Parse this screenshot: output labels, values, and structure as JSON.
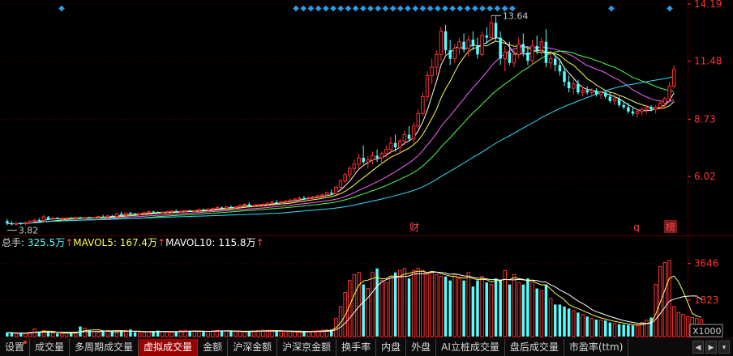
{
  "chart_data": {
    "type": "candlestick",
    "price_axis": {
      "ticks": [
        "14.19",
        "11.48",
        "8.73",
        "6.02"
      ],
      "ylim": [
        3.3,
        14.19
      ]
    },
    "annotations": {
      "high": "13.64",
      "low": "3.82",
      "markers": [
        "财",
        "q",
        "榜"
      ]
    },
    "candles": [
      [
        3.9,
        4.0,
        3.7,
        3.8
      ],
      [
        3.8,
        3.9,
        3.7,
        3.75
      ],
      [
        3.75,
        3.85,
        3.7,
        3.8
      ],
      [
        3.8,
        3.85,
        3.72,
        3.78
      ],
      [
        3.78,
        3.9,
        3.7,
        3.82
      ],
      [
        3.82,
        3.95,
        3.8,
        3.9
      ],
      [
        3.9,
        4.0,
        3.85,
        3.95
      ],
      [
        3.95,
        4.05,
        3.9,
        3.93
      ],
      [
        3.93,
        4.2,
        3.9,
        4.1
      ],
      [
        4.1,
        4.15,
        3.95,
        4.0
      ],
      [
        4.0,
        4.1,
        3.95,
        4.05
      ],
      [
        4.05,
        4.1,
        3.98,
        4.0
      ],
      [
        4.0,
        4.05,
        3.95,
        4.02
      ],
      [
        4.02,
        4.1,
        3.98,
        4.05
      ],
      [
        4.05,
        4.1,
        4.0,
        4.03
      ],
      [
        4.03,
        4.1,
        4.0,
        4.08
      ],
      [
        4.08,
        4.12,
        4.02,
        4.05
      ],
      [
        4.05,
        4.1,
        4.0,
        4.07
      ],
      [
        4.07,
        4.12,
        4.03,
        4.05
      ],
      [
        4.05,
        4.1,
        4.0,
        4.08
      ],
      [
        4.08,
        4.15,
        4.05,
        4.12
      ],
      [
        4.12,
        4.2,
        4.08,
        4.1
      ],
      [
        4.1,
        4.18,
        4.05,
        4.15
      ],
      [
        4.15,
        4.2,
        4.1,
        4.12
      ],
      [
        4.12,
        4.3,
        4.1,
        4.25
      ],
      [
        4.25,
        4.35,
        4.15,
        4.2
      ],
      [
        4.2,
        4.3,
        4.15,
        4.28
      ],
      [
        4.28,
        4.35,
        4.2,
        4.25
      ],
      [
        4.25,
        4.3,
        4.15,
        4.2
      ],
      [
        4.2,
        4.3,
        4.18,
        4.27
      ],
      [
        4.27,
        4.35,
        4.22,
        4.3
      ],
      [
        4.3,
        4.4,
        4.25,
        4.35
      ],
      [
        4.35,
        4.4,
        4.28,
        4.32
      ],
      [
        4.32,
        4.38,
        4.28,
        4.3
      ],
      [
        4.3,
        4.35,
        4.25,
        4.33
      ],
      [
        4.33,
        4.4,
        4.3,
        4.35
      ],
      [
        4.35,
        4.4,
        4.3,
        4.38
      ],
      [
        4.38,
        4.45,
        4.3,
        4.35
      ],
      [
        4.35,
        4.4,
        4.3,
        4.37
      ],
      [
        4.37,
        4.42,
        4.32,
        4.4
      ],
      [
        4.4,
        4.45,
        4.35,
        4.38
      ],
      [
        4.38,
        4.42,
        4.33,
        4.4
      ],
      [
        4.4,
        4.5,
        4.35,
        4.45
      ],
      [
        4.45,
        4.5,
        4.38,
        4.42
      ],
      [
        4.42,
        4.5,
        4.4,
        4.48
      ],
      [
        4.48,
        4.55,
        4.42,
        4.5
      ],
      [
        4.5,
        4.6,
        4.45,
        4.55
      ],
      [
        4.55,
        4.6,
        4.5,
        4.52
      ],
      [
        4.52,
        4.6,
        4.5,
        4.58
      ],
      [
        4.58,
        4.65,
        4.5,
        4.55
      ],
      [
        4.55,
        4.6,
        4.5,
        4.58
      ],
      [
        4.58,
        4.7,
        4.55,
        4.65
      ],
      [
        4.65,
        4.75,
        4.6,
        4.7
      ],
      [
        4.7,
        4.8,
        4.6,
        4.62
      ],
      [
        4.62,
        4.7,
        4.55,
        4.65
      ],
      [
        4.65,
        4.72,
        4.6,
        4.68
      ],
      [
        4.68,
        4.75,
        4.62,
        4.7
      ],
      [
        4.7,
        4.8,
        4.65,
        4.75
      ],
      [
        4.75,
        4.85,
        4.7,
        4.8
      ],
      [
        4.8,
        4.9,
        4.72,
        4.78
      ],
      [
        4.78,
        4.85,
        4.7,
        4.82
      ],
      [
        4.82,
        4.9,
        4.75,
        4.85
      ],
      [
        4.85,
        4.95,
        4.8,
        4.9
      ],
      [
        4.9,
        5.0,
        4.85,
        4.95
      ],
      [
        4.95,
        5.05,
        4.88,
        5.0
      ],
      [
        5.0,
        5.1,
        4.9,
        4.98
      ],
      [
        4.98,
        5.05,
        4.9,
        5.02
      ],
      [
        5.02,
        5.1,
        4.95,
        5.05
      ],
      [
        5.05,
        5.15,
        5.0,
        5.1
      ],
      [
        5.1,
        5.2,
        5.05,
        5.15
      ],
      [
        5.15,
        5.3,
        5.1,
        5.25
      ],
      [
        5.25,
        5.4,
        5.15,
        5.2
      ],
      [
        5.2,
        5.6,
        5.15,
        5.5
      ],
      [
        5.5,
        5.9,
        5.4,
        5.8
      ],
      [
        5.8,
        6.2,
        5.7,
        6.1
      ],
      [
        6.1,
        6.5,
        5.9,
        6.4
      ],
      [
        6.4,
        6.8,
        6.2,
        6.6
      ],
      [
        6.6,
        7.1,
        6.4,
        6.9
      ],
      [
        6.9,
        7.5,
        6.6,
        6.7
      ],
      [
        6.7,
        7.0,
        6.4,
        6.8
      ],
      [
        6.8,
        7.2,
        6.6,
        7.0
      ],
      [
        7.0,
        7.3,
        6.7,
        6.9
      ],
      [
        6.9,
        7.2,
        6.6,
        7.1
      ],
      [
        7.1,
        7.5,
        6.9,
        7.3
      ],
      [
        7.3,
        7.9,
        7.1,
        7.6
      ],
      [
        7.6,
        8.0,
        7.2,
        7.4
      ],
      [
        7.4,
        7.8,
        7.1,
        7.7
      ],
      [
        7.7,
        8.2,
        7.5,
        8.0
      ],
      [
        8.0,
        8.4,
        7.7,
        7.8
      ],
      [
        7.8,
        8.6,
        7.6,
        8.4
      ],
      [
        8.4,
        9.2,
        8.2,
        9.0
      ],
      [
        9.0,
        10.0,
        8.9,
        9.8
      ],
      [
        9.8,
        11.0,
        9.6,
        10.8
      ],
      [
        10.8,
        11.6,
        10.4,
        11.2
      ],
      [
        11.2,
        12.0,
        10.8,
        11.8
      ],
      [
        11.8,
        13.1,
        11.5,
        12.9
      ],
      [
        12.9,
        13.2,
        11.8,
        12.0
      ],
      [
        12.0,
        12.5,
        11.3,
        11.6
      ],
      [
        11.6,
        12.3,
        11.4,
        12.1
      ],
      [
        12.1,
        12.6,
        11.8,
        12.4
      ],
      [
        12.4,
        12.8,
        11.9,
        12.1
      ],
      [
        12.1,
        12.7,
        11.7,
        12.5
      ],
      [
        12.5,
        12.9,
        12.0,
        12.2
      ],
      [
        12.2,
        12.6,
        11.6,
        11.8
      ],
      [
        11.8,
        12.9,
        11.7,
        12.7
      ],
      [
        12.7,
        13.1,
        12.3,
        12.6
      ],
      [
        12.6,
        13.64,
        12.5,
        13.3
      ],
      [
        13.3,
        13.6,
        12.4,
        12.6
      ],
      [
        12.6,
        12.9,
        11.3,
        11.6
      ],
      [
        11.6,
        12.2,
        11.0,
        11.9
      ],
      [
        11.9,
        12.4,
        11.3,
        11.4
      ],
      [
        11.4,
        12.0,
        11.2,
        11.8
      ],
      [
        11.8,
        12.6,
        11.6,
        12.3
      ],
      [
        12.3,
        12.8,
        11.7,
        11.9
      ],
      [
        11.9,
        12.2,
        11.3,
        11.5
      ],
      [
        11.5,
        12.5,
        11.3,
        12.2
      ],
      [
        12.2,
        12.7,
        11.8,
        12.0
      ],
      [
        12.0,
        12.6,
        11.7,
        12.4
      ],
      [
        12.4,
        13.0,
        11.2,
        11.4
      ],
      [
        11.4,
        11.9,
        11.1,
        11.6
      ],
      [
        11.6,
        11.8,
        11.0,
        11.3
      ],
      [
        11.3,
        11.6,
        10.8,
        11.0
      ],
      [
        11.0,
        11.2,
        10.3,
        10.5
      ],
      [
        10.5,
        10.8,
        10.0,
        10.2
      ],
      [
        10.2,
        10.6,
        9.9,
        10.4
      ],
      [
        10.4,
        10.6,
        9.9,
        10.0
      ],
      [
        10.0,
        10.3,
        9.8,
        10.1
      ],
      [
        10.1,
        10.3,
        9.9,
        10.0
      ],
      [
        10.0,
        10.2,
        9.8,
        10.1
      ],
      [
        10.1,
        10.2,
        9.8,
        9.9
      ],
      [
        9.9,
        10.1,
        9.7,
        10.0
      ],
      [
        10.0,
        10.1,
        9.7,
        9.8
      ],
      [
        9.8,
        10.0,
        9.5,
        9.6
      ],
      [
        9.6,
        9.9,
        9.4,
        9.7
      ],
      [
        9.7,
        9.8,
        9.3,
        9.4
      ],
      [
        9.4,
        9.6,
        9.2,
        9.3
      ],
      [
        9.3,
        9.5,
        9.0,
        9.1
      ],
      [
        9.1,
        9.3,
        8.9,
        9.0
      ],
      [
        9.0,
        9.2,
        8.8,
        9.1
      ],
      [
        9.1,
        9.3,
        8.9,
        9.2
      ],
      [
        9.2,
        9.4,
        9.0,
        9.3
      ],
      [
        9.3,
        9.4,
        9.1,
        9.2
      ],
      [
        9.2,
        9.4,
        9.0,
        9.3
      ],
      [
        9.3,
        9.6,
        9.2,
        9.5
      ],
      [
        9.5,
        9.8,
        9.3,
        9.7
      ],
      [
        9.7,
        10.5,
        9.6,
        10.3
      ],
      [
        10.3,
        11.3,
        10.2,
        11.1
      ]
    ],
    "ma_colors": [
      "#ffffff",
      "#ffff50",
      "#ff60ff",
      "#50ff50",
      "#30e0ff"
    ],
    "ma_periods": [
      5,
      10,
      20,
      30,
      60
    ],
    "volume": {
      "legend": {
        "total_label": "总手:",
        "total_value": "325.5万",
        "mavol5_label": "MAVOL5:",
        "mavol5_value": "167.4万",
        "mavol10_label": "MAVOL10:",
        "mavol10_value": "115.8万",
        "arrow": "↑"
      },
      "ticks": [
        "3646",
        "1823"
      ],
      "unit": "X1000",
      "ylim": [
        0,
        4200
      ],
      "values": [
        200,
        180,
        150,
        160,
        170,
        220,
        380,
        250,
        300,
        200,
        180,
        160,
        150,
        170,
        190,
        200,
        500,
        420,
        300,
        250,
        220,
        260,
        300,
        240,
        200,
        280,
        310,
        350,
        220,
        190,
        200,
        240,
        270,
        300,
        250,
        230,
        210,
        260,
        300,
        320,
        280,
        260,
        240,
        250,
        270,
        290,
        310,
        300,
        280,
        260,
        250,
        240,
        230,
        260,
        280,
        300,
        320,
        310,
        290,
        280,
        260,
        250,
        240,
        230,
        220,
        240,
        260,
        280,
        300,
        320,
        330,
        350,
        900,
        1500,
        2200,
        2800,
        3100,
        3200,
        2600,
        2400,
        3200,
        3400,
        2800,
        2700,
        3000,
        3200,
        3300,
        3400,
        2900,
        3300,
        3400,
        3300,
        3100,
        3200,
        3100,
        3000,
        3000,
        2800,
        3100,
        2900,
        2800,
        3200,
        2500,
        2800,
        3000,
        2700,
        2600,
        2900,
        2800,
        3300,
        2600,
        3100,
        2700,
        2600,
        2900,
        2700,
        2400,
        2300,
        2600,
        1900,
        1600,
        1600,
        1500,
        1400,
        1300,
        1200,
        1100,
        1000,
        900,
        850,
        820,
        800,
        700,
        650,
        620,
        600,
        580,
        560,
        540,
        700,
        820,
        950,
        2600,
        3500,
        3700,
        3800,
        1500,
        1200,
        1100,
        1000,
        950,
        900,
        850
      ]
    }
  },
  "top_markers": {
    "symbol": "◆"
  },
  "tabs": [
    {
      "label": "设置",
      "dot": true
    },
    {
      "label": "成交量"
    },
    {
      "label": "多周期成交量"
    },
    {
      "label": "虚拟成交量",
      "active": true
    },
    {
      "label": "金额"
    },
    {
      "label": "沪深金额"
    },
    {
      "label": "沪深京金额"
    },
    {
      "label": "换手率"
    },
    {
      "label": "内盘"
    },
    {
      "label": "外盘"
    },
    {
      "label": "AI立桩成交量"
    },
    {
      "label": "盘后成交量"
    },
    {
      "label": "市盈率(ttm)"
    }
  ],
  "tab_controls": [
    "◀",
    "▶",
    "▾"
  ],
  "colors": {
    "up": "#ff3232",
    "down": "#54ffff",
    "grid": "#5a0000",
    "axis_text": "#ff3232",
    "price_text": "#ff3232"
  }
}
